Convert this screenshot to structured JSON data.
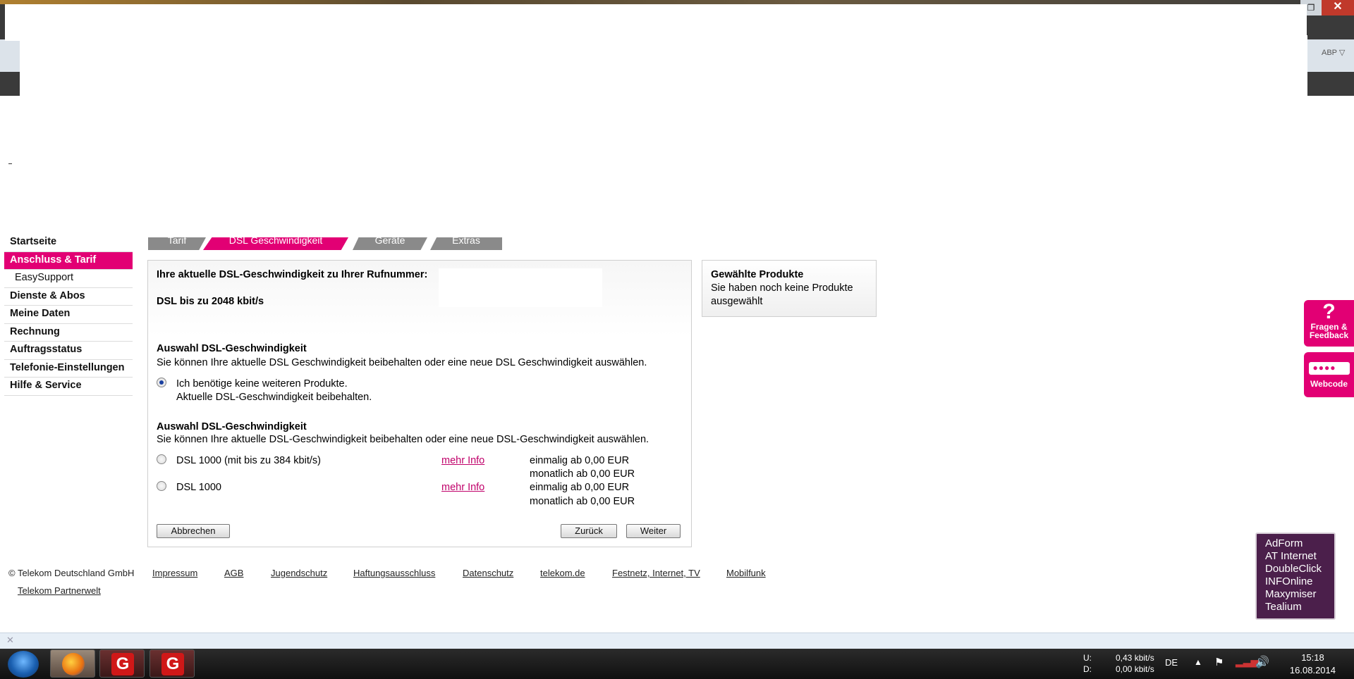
{
  "window": {
    "close_label": "✕",
    "restore_label": "❐",
    "addon_label": "ABP ▽"
  },
  "nav": {
    "items": [
      {
        "label": "Startseite"
      },
      {
        "label": "Anschluss & Tarif"
      },
      {
        "label": "EasySupport"
      },
      {
        "label": "Dienste & Abos"
      },
      {
        "label": "Meine Daten"
      },
      {
        "label": "Rechnung"
      },
      {
        "label": "Auftragsstatus"
      },
      {
        "label": "Telefonie-Einstellungen"
      },
      {
        "label": "Hilfe & Service"
      }
    ],
    "active": "Anschluss & Tarif"
  },
  "steps": [
    {
      "label": "Tarif"
    },
    {
      "label": "DSL Geschwindigkeit"
    },
    {
      "label": "Geräte"
    },
    {
      "label": "Extras"
    }
  ],
  "current": {
    "heading": "Ihre aktuelle DSL-Geschwindigkeit zu Ihrer Rufnummer:",
    "speed": "DSL bis zu 2048 kbit/s"
  },
  "section1": {
    "title": "Auswahl DSL-Geschwindigkeit",
    "desc": "Sie können Ihre aktuelle DSL Geschwindigkeit beibehalten oder eine neue DSL Geschwindigkeit auswählen.",
    "option_line1": "Ich benötige keine weiteren Produkte.",
    "option_line2": "Aktuelle DSL-Geschwindigkeit beibehalten."
  },
  "section2": {
    "title": "Auswahl DSL-Geschwindigkeit",
    "desc": "Sie können Ihre aktuelle DSL-Geschwindigkeit beibehalten oder eine neue DSL-Geschwindigkeit auswählen.",
    "options": [
      {
        "name": "DSL 1000 (mit bis zu 384 kbit/s)",
        "link": "mehr Info",
        "once": "einmalig ab 0,00 EUR",
        "monthly": "monatlich ab 0,00 EUR"
      },
      {
        "name": "DSL 1000",
        "link": "mehr Info",
        "once": "einmalig ab 0,00 EUR",
        "monthly": "monatlich ab 0,00 EUR"
      }
    ]
  },
  "buttons": {
    "cancel": "Abbrechen",
    "back": "Zurück",
    "next": "Weiter"
  },
  "selected": {
    "title": "Gewählte Produkte",
    "text": "Sie haben noch keine Produkte ausgewählt"
  },
  "widgets": {
    "fragen_symbol": "?",
    "fragen_line1": "Fragen &",
    "fragen_line2": "Feedback",
    "webcode_box": "●●●●",
    "webcode_label": "Webcode"
  },
  "footer": {
    "copyright": "© Telekom Deutschland GmbH",
    "links": [
      "Impressum",
      "AGB",
      "Jugendschutz",
      "Haftungsausschluss",
      "Datenschutz",
      "telekom.de",
      "Festnetz, Internet, TV",
      "Mobilfunk",
      "Telekom Partnerwelt"
    ]
  },
  "trackers": [
    "AdForm",
    "AT Internet",
    "DoubleClick",
    "INFOnline",
    "Maxymiser",
    "Tealium"
  ],
  "notification": {
    "close": "✕"
  },
  "taskbar": {
    "g_label": "G",
    "upload_label": "U:",
    "download_label": "D:",
    "upload_rate": "0,43 kbit/s",
    "download_rate": "0,00 kbit/s",
    "lang": "DE",
    "time": "15:18",
    "date": "16.08.2014"
  },
  "colors": {
    "magenta": "#e20074",
    "tracker_bg": "#4b1f4b"
  }
}
